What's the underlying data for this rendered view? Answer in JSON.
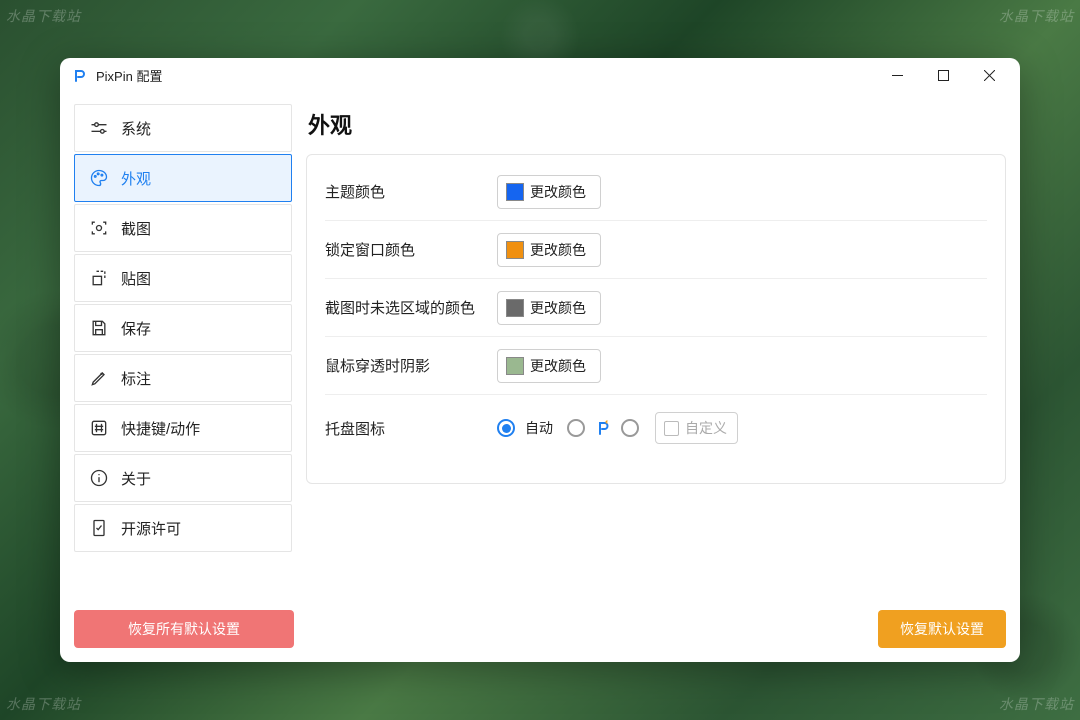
{
  "watermark": "水晶下载站",
  "window": {
    "title": "PixPin 配置"
  },
  "sidebar": {
    "items": [
      {
        "label": "系统"
      },
      {
        "label": "外观"
      },
      {
        "label": "截图"
      },
      {
        "label": "贴图"
      },
      {
        "label": "保存"
      },
      {
        "label": "标注"
      },
      {
        "label": "快捷键/动作"
      },
      {
        "label": "关于"
      },
      {
        "label": "开源许可"
      }
    ]
  },
  "main": {
    "heading": "外观",
    "rows": {
      "theme_color": {
        "label": "主题颜色",
        "button": "更改颜色",
        "swatch": "#1565f0"
      },
      "lock_window_color": {
        "label": "锁定窗口颜色",
        "button": "更改颜色",
        "swatch": "#f09010"
      },
      "unselected_area_color": {
        "label": "截图时未选区域的颜色",
        "button": "更改颜色",
        "swatch": "#6a6a6a"
      },
      "mouse_through_shadow": {
        "label": "鼠标穿透时阴影",
        "button": "更改颜色",
        "swatch": "#9ab890"
      },
      "tray_icon": {
        "label": "托盘图标",
        "auto": "自动",
        "custom": "自定义"
      }
    }
  },
  "footer": {
    "restore_all": "恢复所有默认设置",
    "restore_defaults": "恢复默认设置"
  }
}
